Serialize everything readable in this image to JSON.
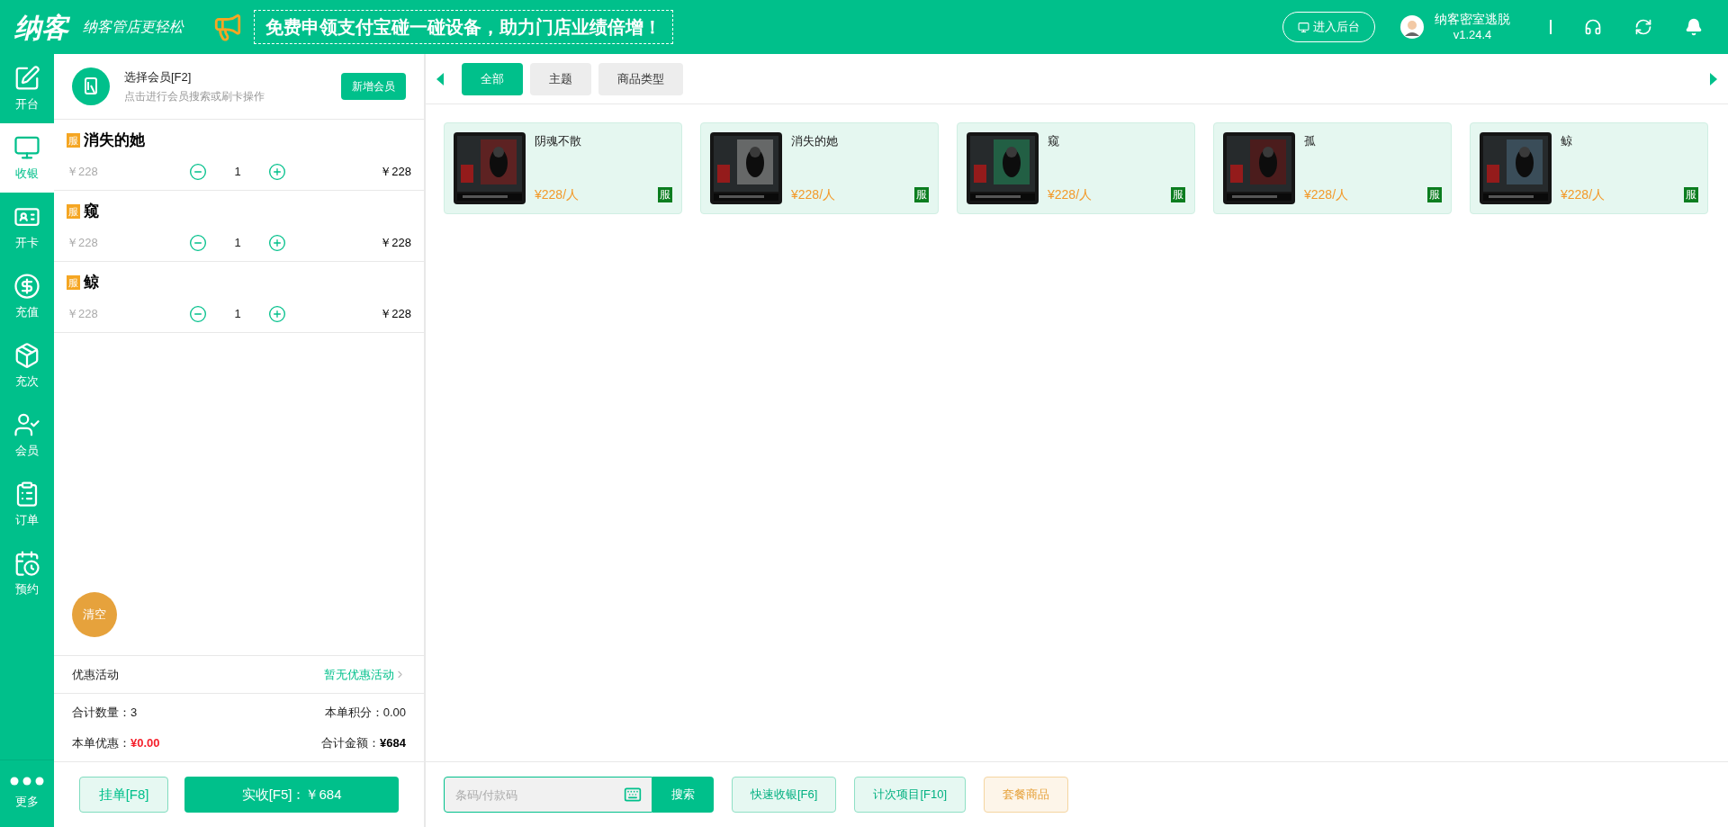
{
  "header": {
    "logo": "纳客",
    "slogan": "纳客管店更轻松",
    "banner": "免费申领支付宝碰一碰设备，助力门店业绩倍增！",
    "backend_button": "进入后台",
    "store_name": "纳客密室逃脱",
    "version": "v1.24.4"
  },
  "nav": {
    "items": [
      {
        "label": "开台",
        "selected": false
      },
      {
        "label": "收银",
        "selected": true
      },
      {
        "label": "开卡",
        "selected": false
      },
      {
        "label": "充值",
        "selected": false
      },
      {
        "label": "充次",
        "selected": false
      },
      {
        "label": "会员",
        "selected": false
      },
      {
        "label": "订单",
        "selected": false
      },
      {
        "label": "预约",
        "selected": false
      }
    ],
    "more": "更多"
  },
  "member": {
    "title": "选择会员[F2]",
    "hint": "点击进行会员搜索或刷卡操作",
    "add_button": "新增会员"
  },
  "cart": [
    {
      "tag": "服",
      "name": "消失的她",
      "unit_price": "￥228",
      "qty": "1",
      "total": "￥228"
    },
    {
      "tag": "服",
      "name": "窥",
      "unit_price": "￥228",
      "qty": "1",
      "total": "￥228"
    },
    {
      "tag": "服",
      "name": "鲸",
      "unit_price": "￥228",
      "qty": "1",
      "total": "￥228"
    }
  ],
  "clear_button": "清空",
  "promotion": {
    "label": "优惠活动",
    "value": "暂无优惠活动"
  },
  "totals": {
    "count_label": "合计数量：",
    "count": "3",
    "points_label": "本单积分：",
    "points": "0.00",
    "discount_label": "本单优惠：",
    "discount": "¥0.00",
    "amount_label": "合计金额：",
    "amount": "¥684"
  },
  "actions": {
    "hold": "挂单[F8]",
    "pay": "实收[F5]：￥684"
  },
  "tabs": [
    {
      "label": "全部",
      "selected": true
    },
    {
      "label": "主题",
      "selected": false
    },
    {
      "label": "商品类型",
      "selected": false
    }
  ],
  "products": [
    {
      "name": "阴魂不散",
      "price": "¥228/人",
      "tag": "服",
      "kind": "picture"
    },
    {
      "name": "消失的她",
      "price": "¥228/人",
      "tag": "服",
      "kind": "picture"
    },
    {
      "name": "窥",
      "price": "¥228/人",
      "tag": "服",
      "kind": "picture"
    },
    {
      "name": "孤",
      "price": "¥228/人",
      "tag": "服",
      "kind": "picture"
    },
    {
      "name": "鲸",
      "price": "¥228/人",
      "tag": "服",
      "kind": "picture"
    }
  ],
  "search": {
    "placeholder": "条码/付款码",
    "button": "搜索"
  },
  "bottom_buttons": [
    {
      "label": "快速收银[F6]",
      "kind": "green"
    },
    {
      "label": "计次项目[F10]",
      "kind": "green"
    },
    {
      "label": "套餐商品",
      "kind": "orange"
    }
  ]
}
